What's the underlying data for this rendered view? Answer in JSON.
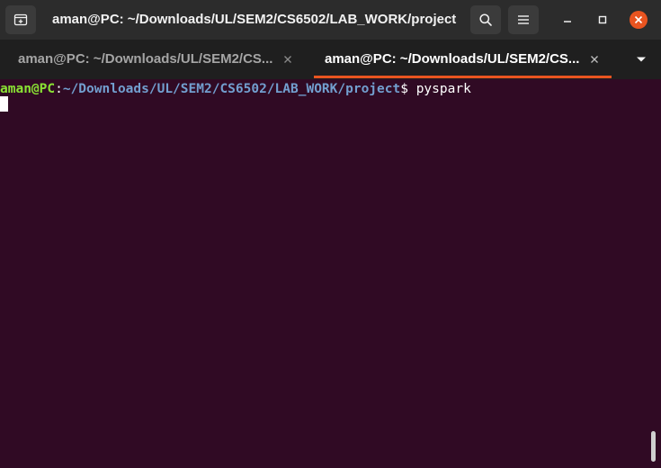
{
  "window": {
    "title": "aman@PC: ~/Downloads/UL/SEM2/CS6502/LAB_WORK/project",
    "icons": {
      "new_tab": "new-tab-icon",
      "search": "search-icon",
      "menu": "hamburger-menu-icon",
      "minimize": "minimize-icon",
      "maximize": "maximize-icon",
      "close": "close-icon"
    }
  },
  "tabs": [
    {
      "label": "aman@PC: ~/Downloads/UL/SEM2/CS...",
      "active": false
    },
    {
      "label": "aman@PC: ~/Downloads/UL/SEM2/CS...",
      "active": true
    }
  ],
  "terminal": {
    "prompt_user": "aman@PC",
    "prompt_sep": ":",
    "prompt_path": "~/Downloads/UL/SEM2/CS6502/LAB_WORK/project",
    "prompt_symbol": "$ ",
    "command": "pyspark"
  },
  "colors": {
    "titlebar_bg": "#2c2c2c",
    "tabbar_bg": "#1f1f1f",
    "terminal_bg": "#300a24",
    "prompt_user": "#8ae234",
    "prompt_path": "#729fcf",
    "active_tab_accent": "#e95420",
    "close_button": "#e95420"
  }
}
